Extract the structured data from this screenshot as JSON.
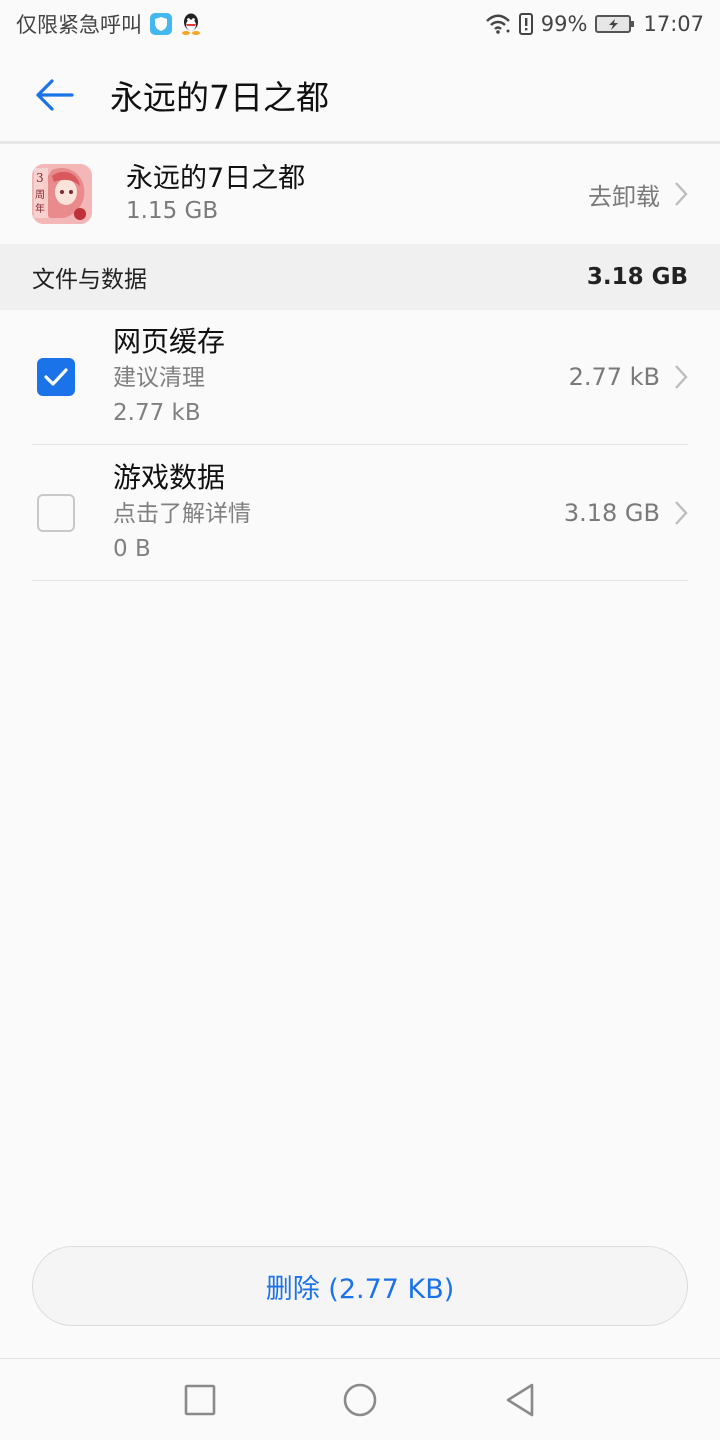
{
  "status_bar": {
    "carrier_text": "仅限紧急呼叫",
    "battery": "99%",
    "time": "17:07",
    "icons": [
      "shield-icon",
      "qq-icon",
      "wifi-icon",
      "alert-icon",
      "battery-charging-icon"
    ]
  },
  "app_bar": {
    "title": "永远的7日之都",
    "back_icon": "arrow-left-icon"
  },
  "app_info": {
    "name": "永远的7日之都",
    "size": "1.15 GB",
    "uninstall_label": "去卸载"
  },
  "section": {
    "label": "文件与数据",
    "total": "3.18 GB"
  },
  "items": [
    {
      "title": "网页缓存",
      "subtitle": "建议清理",
      "selected_size": "2.77 kB",
      "size": "2.77 kB",
      "checked": true
    },
    {
      "title": "游戏数据",
      "subtitle": "点击了解详情",
      "selected_size": "0 B",
      "size": "3.18 GB",
      "checked": false
    }
  ],
  "delete_button": {
    "label": "删除 (2.77 KB)"
  },
  "nav_bar": {
    "icons": [
      "recent-apps-icon",
      "home-icon",
      "back-triangle-icon"
    ]
  },
  "colors": {
    "accent": "#1a73e8",
    "background": "#fafafa",
    "section_bg": "#f0f0f0"
  }
}
